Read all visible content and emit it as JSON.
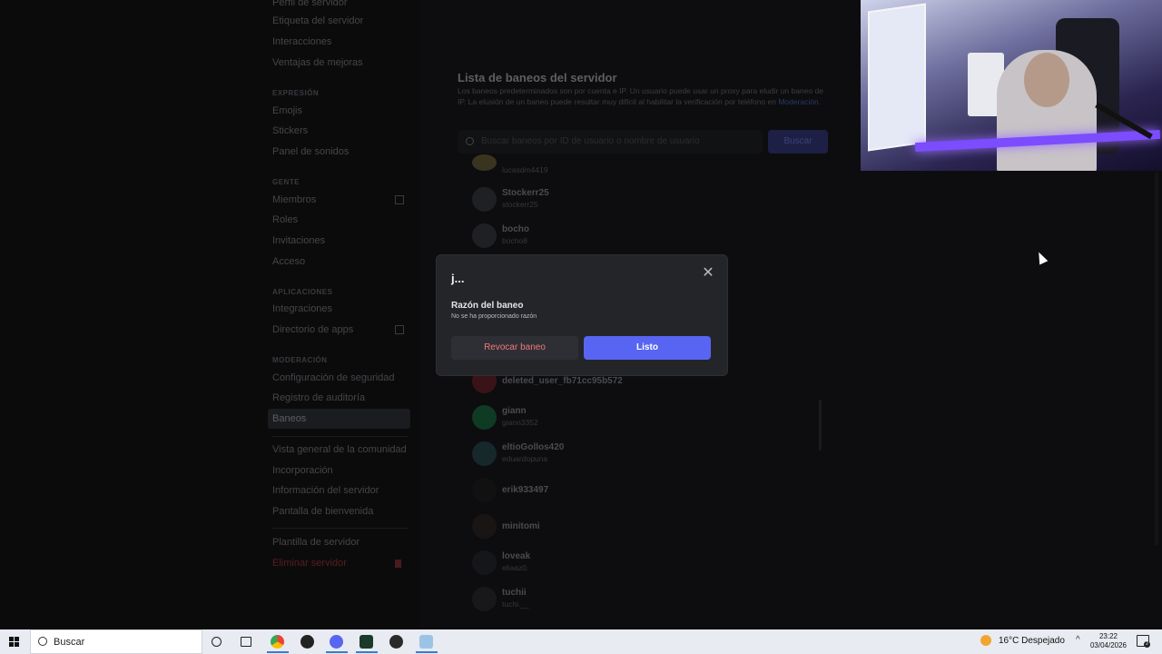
{
  "sidebar": {
    "items_top": [
      "Perfil de servidor",
      "Etiqueta del servidor",
      "Interacciones",
      "Ventajas de mejoras"
    ],
    "section_expression": "EXPRESIÓN",
    "items_expression": [
      "Emojis",
      "Stickers",
      "Panel de sonidos"
    ],
    "section_people": "GENTE",
    "items_people": [
      "Miembros",
      "Roles",
      "Invitaciones",
      "Acceso"
    ],
    "section_apps": "APLICACIONES",
    "items_apps": [
      "Integraciones",
      "Directorio de apps"
    ],
    "section_moderation": "MODERACIÓN",
    "items_moderation": [
      "Configuración de seguridad",
      "Registro de auditoría",
      "Baneos"
    ],
    "items_community": [
      "Vista general de la comunidad",
      "Incorporación",
      "Información del servidor",
      "Pantalla de bienvenida"
    ],
    "server_template": "Plantilla de servidor",
    "delete_server": "Eliminar servidor"
  },
  "main": {
    "title": "Lista de baneos del servidor",
    "description": "Los baneos predeterminados son por cuenta e IP. Un usuario puede usar un proxy para eludir un baneo de IP. La elusión de un baneo puede resultar muy difícil al habilitar la verificación por teléfono en",
    "description_link": "Moderación",
    "search_placeholder": "Buscar baneos por ID de usuario o nombre de usuario",
    "search_button": "Buscar",
    "bans": [
      {
        "name": "",
        "tag": "lucasdm4419"
      },
      {
        "name": "Stockerr25",
        "tag": "stockerr25"
      },
      {
        "name": "bocho",
        "tag": "bocho8"
      },
      {
        "name": "deleted_user_fb71cc95b572",
        "tag": ""
      },
      {
        "name": "giann",
        "tag": "giann3352"
      },
      {
        "name": "eltioGollos420",
        "tag": "eduardopuna"
      },
      {
        "name": "erik933497",
        "tag": ""
      },
      {
        "name": "minitomi",
        "tag": ""
      },
      {
        "name": "loveak",
        "tag": "eliaaz0."
      },
      {
        "name": "tuchii",
        "tag": "tuchi.__"
      }
    ]
  },
  "modal": {
    "title": "j...",
    "reason_label": "Razón del baneo",
    "reason_text": "No se ha proporcionado razón",
    "revoke_button": "Revocar baneo",
    "done_button": "Listo"
  },
  "taskbar": {
    "search_text": "Buscar",
    "weather": "16°C  Despejado",
    "time": "23:22",
    "date": "03/04/2026",
    "notifications": "2"
  },
  "colors": {
    "accent": "#5865f2",
    "danger": "#f0787c",
    "modal_bg": "#242529"
  }
}
